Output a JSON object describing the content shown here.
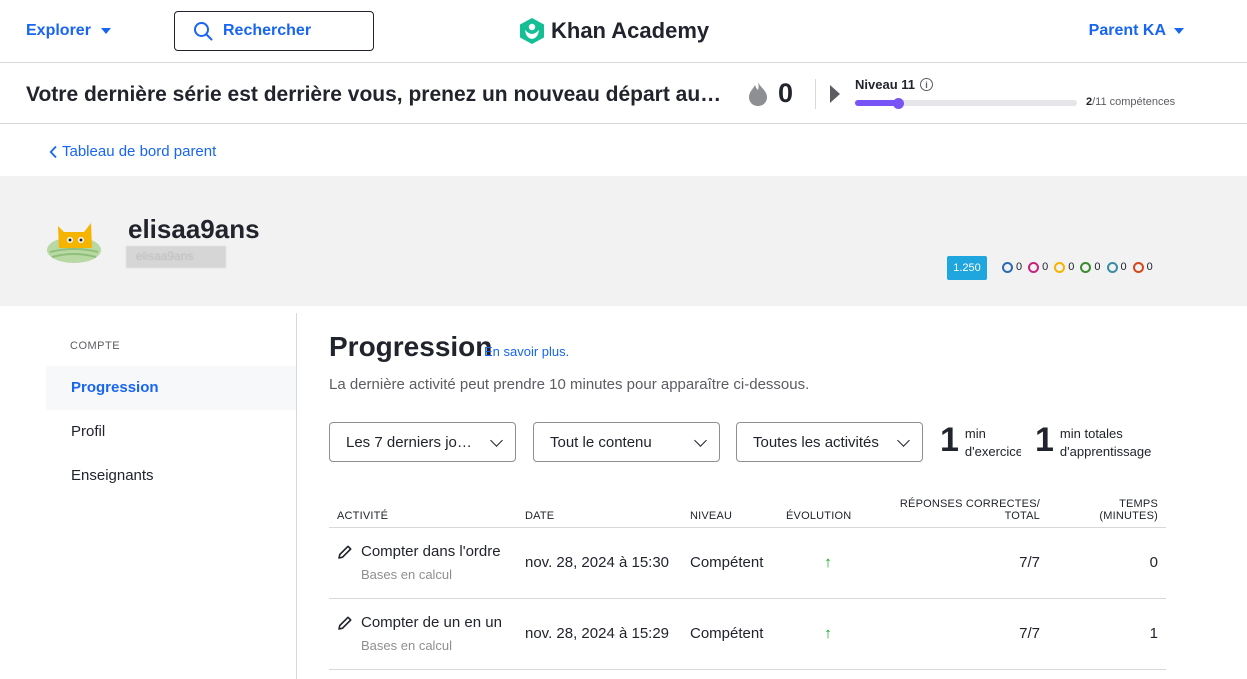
{
  "nav": {
    "explore_label": "Explorer",
    "search_label": "Rechercher",
    "logo_text": "Khan Academy",
    "user_label": "Parent KA"
  },
  "streak": {
    "message": "Votre dernière série est derrière vous, prenez un nouveau départ au…",
    "count": "0",
    "level_label": "Niveau 11",
    "skills_done": "2",
    "skills_total": "/11 compétences",
    "level_progress": 0.2
  },
  "back_link": "Tableau de bord parent",
  "profile": {
    "username": "elisaa9ans",
    "handle": "elisaa9ans",
    "points": "1.250",
    "badges": [
      {
        "name": "meteorite",
        "count": "0",
        "color": "#2b6cb0"
      },
      {
        "name": "moon",
        "count": "0",
        "color": "#c4257e"
      },
      {
        "name": "earth",
        "count": "0",
        "color": "#f5b400"
      },
      {
        "name": "sun",
        "count": "0",
        "color": "#3b8c2e"
      },
      {
        "name": "black-hole",
        "count": "0",
        "color": "#3a8d9e"
      },
      {
        "name": "challenge",
        "count": "0",
        "color": "#d6481c"
      }
    ]
  },
  "sidebar": {
    "heading": "COMPTE",
    "items": [
      {
        "label": "Progression"
      },
      {
        "label": "Profil"
      },
      {
        "label": "Enseignants"
      }
    ]
  },
  "main": {
    "title": "Progression",
    "learn_more": "En savoir plus.",
    "subtitle": "La dernière activité peut prendre 10 minutes pour apparaître ci-dessous.",
    "filters": {
      "period": "Les 7 derniers jo…",
      "content": "Tout le contenu",
      "activities": "Toutes les activités"
    },
    "stats": {
      "exercise_value": "1",
      "exercise_label_1": "min",
      "exercise_label_2": "d'exercice",
      "learning_value": "1",
      "learning_label_1": "min totales",
      "learning_label_2": "d'apprentissage"
    },
    "table": {
      "headers": {
        "activity": "ACTIVITÉ",
        "date": "DATE",
        "level": "NIVEAU",
        "evolution": "ÉVOLUTION",
        "correct_1": "RÉPONSES CORRECTES/",
        "correct_2": "TOTAL",
        "time_1": "TEMPS",
        "time_2": "(MINUTES)"
      },
      "rows": [
        {
          "activity": "Compter dans l'ordre",
          "course": "Bases en calcul",
          "date": "nov. 28, 2024 à 15:30",
          "level": "Compétent",
          "evolution": "↑",
          "correct": "7/7",
          "time": "0"
        },
        {
          "activity": "Compter de un en un",
          "course": "Bases en calcul",
          "date": "nov. 28, 2024 à 15:29",
          "level": "Compétent",
          "evolution": "↑",
          "correct": "7/7",
          "time": "1"
        }
      ]
    }
  }
}
